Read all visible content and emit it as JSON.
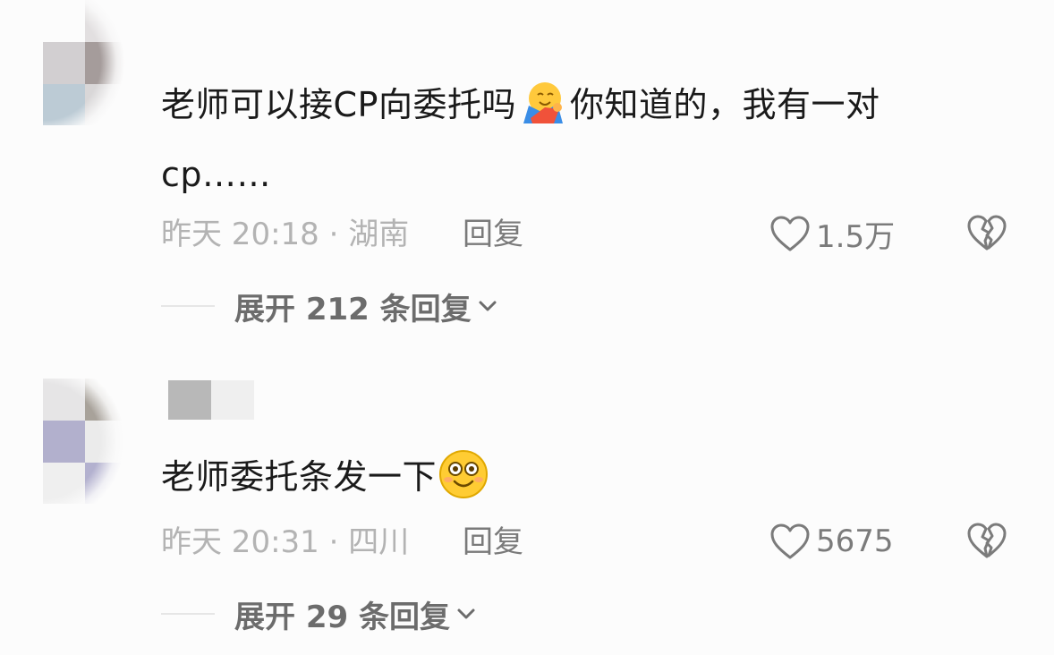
{
  "comments": [
    {
      "text_part1": "老师可以接CP向委托吗",
      "emoji1": "hugging-face-emoji",
      "text_part2": "你知道的，我有一对",
      "text_line2": "cp……",
      "time": "昨天 20:18 · 湖南",
      "reply_label": "回复",
      "likes": "1.5万",
      "expand_label": "展开 212 条回复"
    },
    {
      "text": "老师委托条发一下",
      "emoji": "smiling-face-emoji",
      "time": "昨天 20:31 · 四川",
      "reply_label": "回复",
      "likes": "5675",
      "expand_label": "展开 29 条回复"
    }
  ],
  "colors": {
    "background": "#fcfcfc",
    "text_primary": "#1a1a1a",
    "text_meta": "#b3b3b3",
    "text_secondary": "#7a7a7a"
  }
}
